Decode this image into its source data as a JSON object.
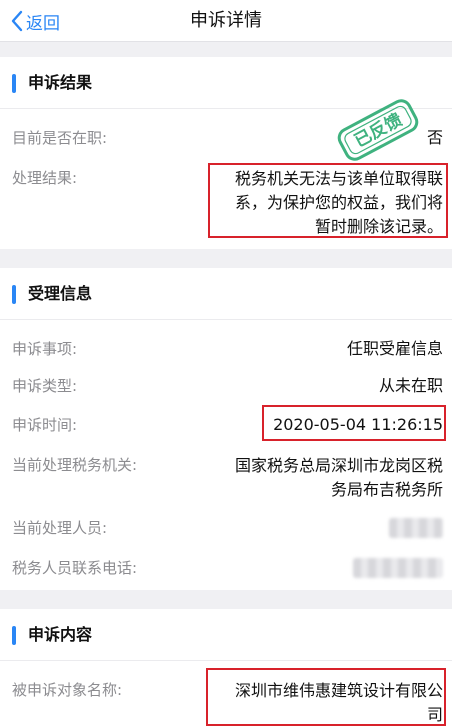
{
  "nav": {
    "back_label": "返回",
    "title": "申诉详情"
  },
  "result_section": {
    "title": "申诉结果",
    "employed_label": "目前是否在职:",
    "employed_value": "否",
    "result_label": "处理结果:",
    "result_lines": [
      "税务机关无法与该单位取得联",
      "系，为保护您的权益，我们将",
      "暂时删除该记录。"
    ],
    "stamp_text": "已反馈"
  },
  "accept_section": {
    "title": "受理信息",
    "items": [
      {
        "label": "申诉事项:",
        "value": "任职受雇信息"
      },
      {
        "label": "申诉类型:",
        "value": "从未在职"
      },
      {
        "label": "申诉时间:",
        "value": "2020-05-04 11:26:15"
      }
    ],
    "authority_label": "当前处理税务机关:",
    "authority_lines": [
      "国家税务总局深圳市龙岗区税",
      "务局布吉税务所"
    ],
    "handler_label": "当前处理人员:",
    "phone_label": "税务人员联系电话:"
  },
  "content_section": {
    "title": "申诉内容",
    "target_label": "被申诉对象名称:",
    "target_lines": [
      "深圳市维伟惠建筑设计有限公",
      "司"
    ]
  },
  "colors": {
    "accent": "#2a86f5",
    "highlight_box": "#d8222b",
    "stamp": "#3fb27f"
  }
}
